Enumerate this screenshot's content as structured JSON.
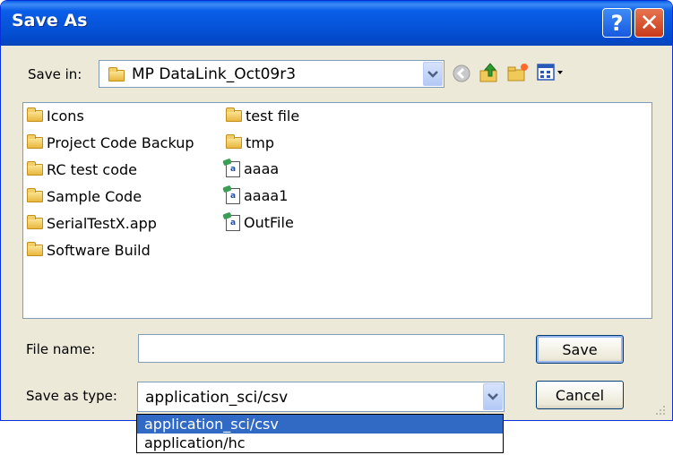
{
  "window": {
    "title": "Save As",
    "help_label": "?",
    "close_label": "✕"
  },
  "save_in": {
    "label": "Save in:",
    "value": "MP DataLink_Oct09r3"
  },
  "toolbar": {
    "back_icon": "back-arrow-icon",
    "up_icon": "up-folder-icon",
    "new_folder_icon": "new-folder-icon",
    "views_icon": "views-menu-icon"
  },
  "files": {
    "col1": [
      {
        "name": "Icons",
        "type": "folder"
      },
      {
        "name": "Project Code Backup",
        "type": "folder"
      },
      {
        "name": "RC test code",
        "type": "folder"
      },
      {
        "name": "Sample Code",
        "type": "folder"
      },
      {
        "name": "SerialTestX.app",
        "type": "folder"
      },
      {
        "name": "Software Build",
        "type": "folder"
      }
    ],
    "col2": [
      {
        "name": "test file",
        "type": "folder"
      },
      {
        "name": "tmp",
        "type": "folder"
      },
      {
        "name": "aaaa",
        "type": "file"
      },
      {
        "name": "aaaa1",
        "type": "file"
      },
      {
        "name": "OutFile",
        "type": "file"
      }
    ]
  },
  "file_name": {
    "label": "File name:",
    "value": ""
  },
  "save_as_type": {
    "label": "Save as type:",
    "value": "application_sci/csv",
    "options": [
      "application_sci/csv",
      "application/hc"
    ]
  },
  "buttons": {
    "save": "Save",
    "cancel": "Cancel"
  }
}
